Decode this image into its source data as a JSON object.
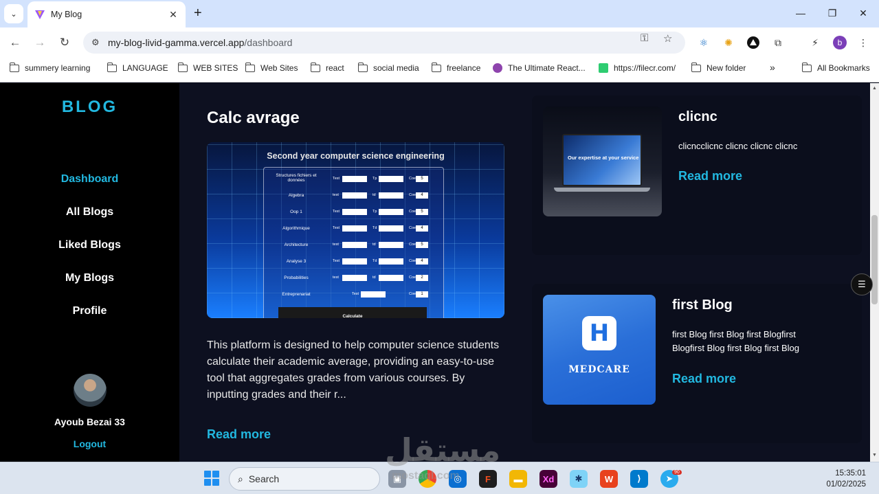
{
  "browser": {
    "tab_title": "My Blog",
    "tab_close": "✕",
    "new_tab": "+",
    "url_host": "my-blog-livid-gamma.vercel.app",
    "url_path": "/dashboard",
    "window_controls": {
      "minimize": "—",
      "maximize": "❐",
      "close": "✕"
    },
    "bookmarks": [
      {
        "label": "summery learning",
        "type": "folder"
      },
      {
        "label": "LANGUAGE",
        "type": "folder"
      },
      {
        "label": "WEB SITES",
        "type": "folder"
      },
      {
        "label": "Web Sites",
        "type": "folder"
      },
      {
        "label": "react",
        "type": "folder"
      },
      {
        "label": "social media",
        "type": "folder"
      },
      {
        "label": "freelance",
        "type": "folder"
      },
      {
        "label": "The Ultimate React...",
        "type": "link"
      },
      {
        "label": "https://filecr.com/",
        "type": "link"
      },
      {
        "label": "New folder",
        "type": "folder"
      }
    ],
    "bookmarks_overflow": "»",
    "all_bookmarks": "All Bookmarks",
    "profile_initial": "b"
  },
  "sidebar": {
    "brand": "BLOG",
    "nav": [
      {
        "label": "Dashboard",
        "active": true
      },
      {
        "label": "All Blogs",
        "active": false
      },
      {
        "label": "Liked Blogs",
        "active": false
      },
      {
        "label": "My Blogs",
        "active": false
      },
      {
        "label": "Profile",
        "active": false
      }
    ],
    "user_name": "Ayoub Bezai 33",
    "logout": "Logout"
  },
  "featured_post": {
    "title": "Calc avrage",
    "image": {
      "heading": "Second year computer science engineering",
      "rows": [
        {
          "subject": "Structures fichiers et données",
          "l1": "Test",
          "l2": "Tp",
          "l3": "Coef",
          "coef": "5"
        },
        {
          "subject": "Algebra",
          "l1": "test",
          "l2": "td",
          "l3": "Coef",
          "coef": "4"
        },
        {
          "subject": "Oop 1",
          "l1": "Test",
          "l2": "Tp",
          "l3": "Coef",
          "coef": "5"
        },
        {
          "subject": "Algorithmique",
          "l1": "Test",
          "l2": "Td",
          "l3": "Coef",
          "coef": "4"
        },
        {
          "subject": "Architecture",
          "l1": "test",
          "l2": "td",
          "l3": "Coef",
          "coef": "5"
        },
        {
          "subject": "Analyse 3",
          "l1": "Test",
          "l2": "Td",
          "l3": "Coef",
          "coef": "4"
        },
        {
          "subject": "Probabilities",
          "l1": "test",
          "l2": "td",
          "l3": "Coef",
          "coef": "2"
        },
        {
          "subject": "Entreprenariat",
          "l1": "Test",
          "l2": "",
          "l3": "Coef",
          "coef": "1"
        }
      ],
      "button": "Calculate"
    },
    "description": "This platform is designed to help computer science students calculate their academic average, providing an easy-to-use tool that aggregates grades from various courses. By inputting grades and their r...",
    "read_more": "Read more"
  },
  "cards": [
    {
      "title": "clicnc",
      "text": "clicncclicnc clicnc clicnc clicnc",
      "read_more": "Read more",
      "image_text": "Our expertise at your service"
    },
    {
      "title": "first Blog",
      "text": "first Blog first Blog first Blogfirst Blogfirst Blog first Blog first Blog",
      "read_more": "Read more",
      "image_logo": "H",
      "image_text": "MEDCARE"
    }
  ],
  "taskbar": {
    "search_placeholder": "Search",
    "telegram_badge": "90",
    "time": "15:35:01",
    "date": "01/02/2025"
  },
  "watermark": {
    "main": "مستقل",
    "sub": "mostaql.com"
  },
  "colors": {
    "accent": "#22b8e0",
    "sidebar_bg": "#000000",
    "main_bg": "#0d1020"
  }
}
